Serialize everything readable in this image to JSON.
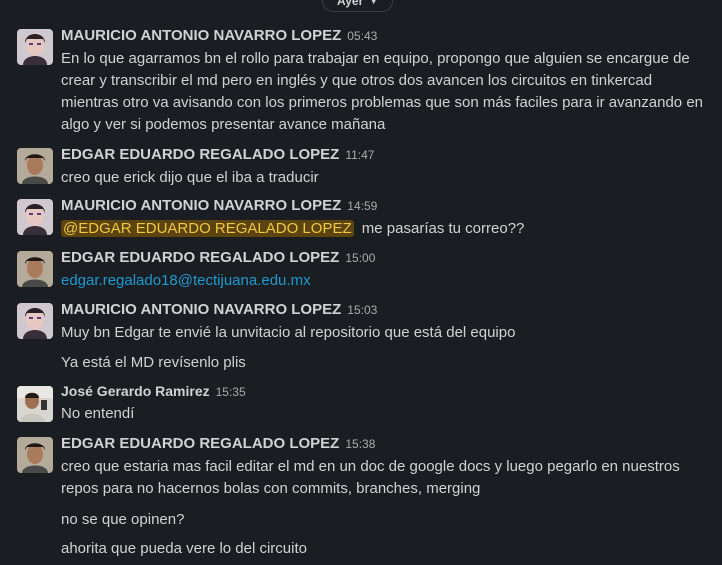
{
  "day_divider": {
    "label": "Ayer"
  },
  "messages": [
    {
      "author": "MAURICIO ANTONIO NAVARRO LOPEZ",
      "time": "05:43",
      "lines": [
        "En lo que agarramos bn el rollo para trabajar en equipo, propongo que alguien se encargue de",
        "crear y transcribir el md pero en inglés y que otros dos avancen  los circuitos en tinkercad",
        "mientras otro va avisando con los primeros problemas que son más faciles para ir avanzando en",
        "algo y ver si podemos presentar avance mañana"
      ]
    },
    {
      "author": "EDGAR EDUARDO REGALADO LOPEZ",
      "time": "11:47",
      "lines": [
        "creo que erick dijo que el iba a traducir"
      ]
    },
    {
      "author": "MAURICIO ANTONIO NAVARRO LOPEZ",
      "time": "14:59",
      "mention": "@EDGAR EDUARDO REGALADO LOPEZ",
      "after_mention": " me pasarías tu correo??"
    },
    {
      "author": "EDGAR EDUARDO REGALADO LOPEZ",
      "time": "15:00",
      "link": "edgar.regalado18@tectijuana.edu.mx"
    },
    {
      "author": "MAURICIO ANTONIO NAVARRO LOPEZ",
      "time": "15:03",
      "lines": [
        "Muy bn Edgar te envié la unvitacio al repositorio que está del equipo"
      ],
      "followups": [
        "Ya está el MD revísenlo plis"
      ]
    },
    {
      "author": "José Gerardo Ramirez",
      "time": "15:35",
      "lines": [
        "No entendí"
      ]
    },
    {
      "author": "EDGAR EDUARDO REGALADO LOPEZ",
      "time": "15:38",
      "lines": [
        "creo que estaria mas facil editar el md en un doc de google docs y luego pegarlo en nuestros",
        "repos para no hacernos bolas con commits, branches, merging"
      ],
      "followups": [
        "no se que opinen?",
        "ahorita que pueda vere lo del circuito"
      ]
    }
  ],
  "colors": {
    "background": "#1a1d21",
    "text": "#d1d2d3",
    "timestamp": "#ababad",
    "link": "#1d9bd1",
    "mention_bg": "#5c4411",
    "mention_text": "#f2c744"
  }
}
